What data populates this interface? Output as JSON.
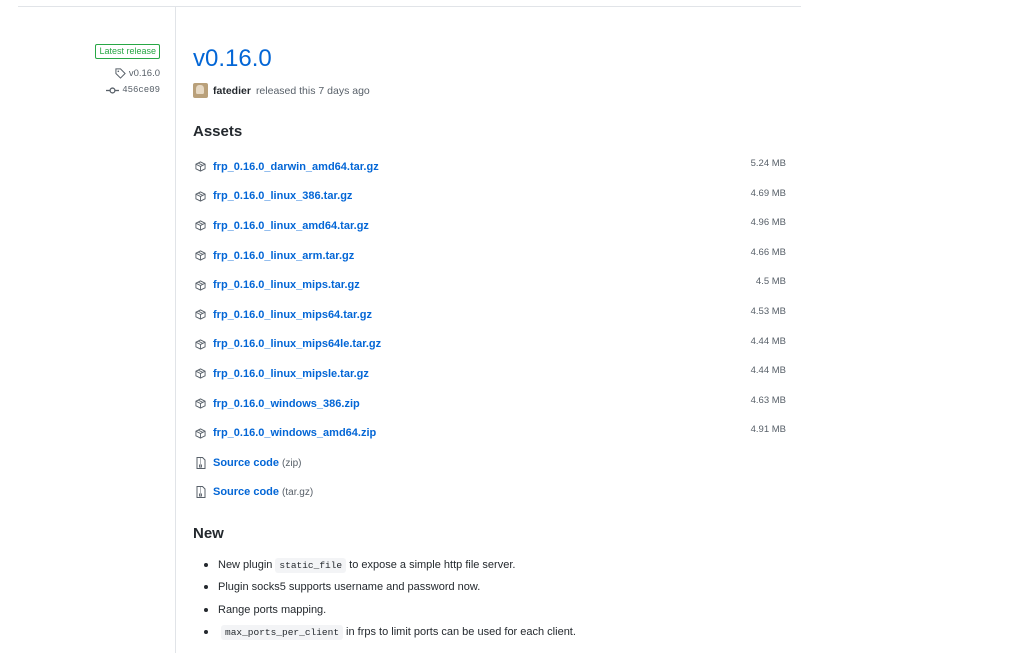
{
  "sidebar": {
    "badge": "Latest release",
    "tag": "v0.16.0",
    "commit": "456ce09"
  },
  "release": {
    "title": "v0.16.0",
    "author": "fatedier",
    "released_text": "released this 7 days ago"
  },
  "assets": {
    "heading": "Assets",
    "files": [
      {
        "name": "frp_0.16.0_darwin_amd64.tar.gz",
        "size": "5.24 MB"
      },
      {
        "name": "frp_0.16.0_linux_386.tar.gz",
        "size": "4.69 MB"
      },
      {
        "name": "frp_0.16.0_linux_amd64.tar.gz",
        "size": "4.96 MB"
      },
      {
        "name": "frp_0.16.0_linux_arm.tar.gz",
        "size": "4.66 MB"
      },
      {
        "name": "frp_0.16.0_linux_mips.tar.gz",
        "size": "4.5 MB"
      },
      {
        "name": "frp_0.16.0_linux_mips64.tar.gz",
        "size": "4.53 MB"
      },
      {
        "name": "frp_0.16.0_linux_mips64le.tar.gz",
        "size": "4.44 MB"
      },
      {
        "name": "frp_0.16.0_linux_mipsle.tar.gz",
        "size": "4.44 MB"
      },
      {
        "name": "frp_0.16.0_windows_386.zip",
        "size": "4.63 MB"
      },
      {
        "name": "frp_0.16.0_windows_amd64.zip",
        "size": "4.91 MB"
      }
    ],
    "source": [
      {
        "label": "Source code",
        "ext": "(zip)"
      },
      {
        "label": "Source code",
        "ext": "(tar.gz)"
      }
    ]
  },
  "notes": {
    "heading": "New",
    "items": [
      {
        "pre": "New plugin",
        "code": "static_file",
        "post": "to expose a simple http file server."
      },
      {
        "pre": "Plugin socks5 supports username and password now.",
        "code": "",
        "post": ""
      },
      {
        "pre": "Range ports mapping.",
        "code": "",
        "post": ""
      },
      {
        "pre": "",
        "code": "max_ports_per_client",
        "post": "in frps to limit ports can be used for each client."
      }
    ]
  },
  "colors": {
    "link": "#0366d6",
    "badge": "#28a745",
    "muted": "#586069"
  },
  "icons": {
    "tag": "tag-icon",
    "commit": "commit-icon",
    "package": "package-icon",
    "file-zip": "file-zip-icon"
  }
}
